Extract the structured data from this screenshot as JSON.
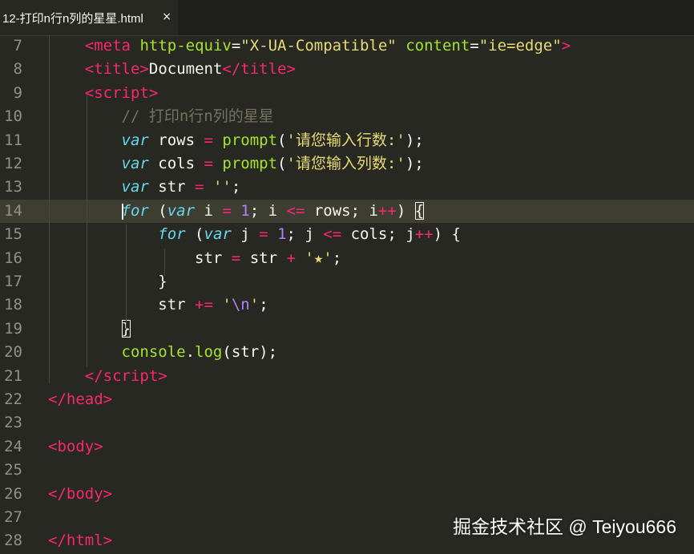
{
  "tab": {
    "label": "12-打印n行n列的星星.html",
    "close": "×"
  },
  "lines": [
    {
      "n": "7",
      "parts": [
        [
          "    ",
          "punct"
        ],
        [
          "<",
          "tag"
        ],
        [
          "meta",
          "tag"
        ],
        [
          " ",
          "punct"
        ],
        [
          "http-equiv",
          "attr"
        ],
        [
          "=",
          "punct"
        ],
        [
          "\"X-UA-Compatible\"",
          "str"
        ],
        [
          " ",
          "punct"
        ],
        [
          "content",
          "attr"
        ],
        [
          "=",
          "punct"
        ],
        [
          "\"ie=edge\"",
          "str"
        ],
        [
          ">",
          "tag"
        ]
      ]
    },
    {
      "n": "8",
      "parts": [
        [
          "    ",
          "punct"
        ],
        [
          "<",
          "tag"
        ],
        [
          "title",
          "tag"
        ],
        [
          ">",
          "tag"
        ],
        [
          "Document",
          "punct"
        ],
        [
          "</",
          "tag"
        ],
        [
          "title",
          "tag"
        ],
        [
          ">",
          "tag"
        ]
      ]
    },
    {
      "n": "9",
      "parts": [
        [
          "    ",
          "punct"
        ],
        [
          "<",
          "tag"
        ],
        [
          "script",
          "tag"
        ],
        [
          ">",
          "tag"
        ]
      ]
    },
    {
      "n": "10",
      "parts": [
        [
          "        ",
          "punct"
        ],
        [
          "// 打印n行n列的星星",
          "cmt"
        ]
      ]
    },
    {
      "n": "11",
      "parts": [
        [
          "        ",
          "punct"
        ],
        [
          "var",
          "kw"
        ],
        [
          " rows ",
          "punct"
        ],
        [
          "=",
          "op"
        ],
        [
          " ",
          "punct"
        ],
        [
          "prompt",
          "fn"
        ],
        [
          "(",
          "punct"
        ],
        [
          "'请您输入行数:'",
          "str"
        ],
        [
          ");",
          "punct"
        ]
      ]
    },
    {
      "n": "12",
      "parts": [
        [
          "        ",
          "punct"
        ],
        [
          "var",
          "kw"
        ],
        [
          " cols ",
          "punct"
        ],
        [
          "=",
          "op"
        ],
        [
          " ",
          "punct"
        ],
        [
          "prompt",
          "fn"
        ],
        [
          "(",
          "punct"
        ],
        [
          "'请您输入列数:'",
          "str"
        ],
        [
          ");",
          "punct"
        ]
      ]
    },
    {
      "n": "13",
      "parts": [
        [
          "        ",
          "punct"
        ],
        [
          "var",
          "kw"
        ],
        [
          " str ",
          "punct"
        ],
        [
          "=",
          "op"
        ],
        [
          " ",
          "punct"
        ],
        [
          "''",
          "str"
        ],
        [
          ";",
          "punct"
        ]
      ]
    },
    {
      "n": "14",
      "current": true,
      "parts": [
        [
          "        ",
          "punct"
        ],
        [
          "for",
          "kw"
        ],
        [
          " (",
          "punct"
        ],
        [
          "var",
          "kw"
        ],
        [
          " i ",
          "punct"
        ],
        [
          "=",
          "op"
        ],
        [
          " ",
          "punct"
        ],
        [
          "1",
          "num"
        ],
        [
          "; i ",
          "punct"
        ],
        [
          "<=",
          "op"
        ],
        [
          " rows; i",
          "punct"
        ],
        [
          "++",
          "op"
        ],
        [
          ") ",
          "punct"
        ],
        [
          "{",
          "bracket"
        ]
      ]
    },
    {
      "n": "15",
      "parts": [
        [
          "            ",
          "punct"
        ],
        [
          "for",
          "kw"
        ],
        [
          " (",
          "punct"
        ],
        [
          "var",
          "kw"
        ],
        [
          " j ",
          "punct"
        ],
        [
          "=",
          "op"
        ],
        [
          " ",
          "punct"
        ],
        [
          "1",
          "num"
        ],
        [
          "; j ",
          "punct"
        ],
        [
          "<=",
          "op"
        ],
        [
          " cols; j",
          "punct"
        ],
        [
          "++",
          "op"
        ],
        [
          ") {",
          "punct"
        ]
      ]
    },
    {
      "n": "16",
      "parts": [
        [
          "                ",
          "punct"
        ],
        [
          "str ",
          "punct"
        ],
        [
          "=",
          "op"
        ],
        [
          " str ",
          "punct"
        ],
        [
          "+",
          "op"
        ],
        [
          " ",
          "punct"
        ],
        [
          "'★'",
          "str"
        ],
        [
          ";",
          "punct"
        ]
      ]
    },
    {
      "n": "17",
      "parts": [
        [
          "            ",
          "punct"
        ],
        [
          "}",
          "punct"
        ]
      ]
    },
    {
      "n": "18",
      "parts": [
        [
          "            ",
          "punct"
        ],
        [
          "str ",
          "punct"
        ],
        [
          "+=",
          "op"
        ],
        [
          " ",
          "punct"
        ],
        [
          "'",
          "str"
        ],
        [
          "\\n",
          "num"
        ],
        [
          "'",
          "str"
        ],
        [
          ";",
          "punct"
        ]
      ]
    },
    {
      "n": "19",
      "parts": [
        [
          "        ",
          "punct"
        ],
        [
          "}",
          "bracket"
        ]
      ]
    },
    {
      "n": "20",
      "parts": [
        [
          "        ",
          "punct"
        ],
        [
          "console",
          "fn"
        ],
        [
          ".",
          "punct"
        ],
        [
          "log",
          "fn"
        ],
        [
          "(str);",
          "punct"
        ]
      ]
    },
    {
      "n": "21",
      "parts": [
        [
          "    ",
          "punct"
        ],
        [
          "</",
          "tag"
        ],
        [
          "script",
          "tag"
        ],
        [
          ">",
          "tag"
        ]
      ]
    },
    {
      "n": "22",
      "parts": [
        [
          "</",
          "tag"
        ],
        [
          "head",
          "tag"
        ],
        [
          ">",
          "tag"
        ]
      ]
    },
    {
      "n": "23",
      "parts": []
    },
    {
      "n": "24",
      "parts": [
        [
          "<",
          "tag"
        ],
        [
          "body",
          "tag"
        ],
        [
          ">",
          "tag"
        ]
      ]
    },
    {
      "n": "25",
      "parts": []
    },
    {
      "n": "26",
      "parts": [
        [
          "</",
          "tag"
        ],
        [
          "body",
          "tag"
        ],
        [
          ">",
          "tag"
        ]
      ]
    },
    {
      "n": "27",
      "parts": []
    },
    {
      "n": "28",
      "parts": [
        [
          "</",
          "tag"
        ],
        [
          "html",
          "tag"
        ],
        [
          ">",
          "tag"
        ]
      ]
    }
  ],
  "watermark": "掘金技术社区 @ Teiyou666",
  "colors": {
    "background": "#272822",
    "tag": "#f92672",
    "keyword": "#66d9ef",
    "string": "#e6db74",
    "function": "#a6e22e",
    "number": "#ae81ff",
    "comment": "#75715e",
    "line_number": "#8f908a"
  }
}
